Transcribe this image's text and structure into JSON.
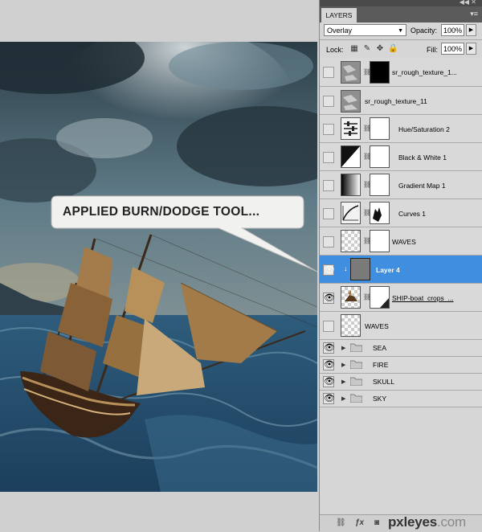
{
  "callout": {
    "text": "APPLIED BURN/DODGE TOOL..."
  },
  "panel": {
    "tab_label": "LAYERS",
    "blend_mode": "Overlay",
    "opacity_label": "Opacity:",
    "opacity_value": "100%",
    "lock_label": "Lock:",
    "fill_label": "Fill:",
    "fill_value": "100%",
    "layers": [
      {
        "name": "sr_rough_texture_1...",
        "visible": false,
        "icons": [
          "texture-thumbnail",
          "link-icon",
          "black-mask-thumbnail"
        ]
      },
      {
        "name": "sr_rough_texture_11",
        "visible": false,
        "icons": [
          "texture-thumbnail"
        ]
      },
      {
        "name": "Hue/Saturation 2",
        "visible": false,
        "icons": [
          "hue-saturation-adjustment-icon",
          "link-icon",
          "white-mask-thumbnail"
        ]
      },
      {
        "name": "Black & White 1",
        "visible": false,
        "icons": [
          "black-white-adjustment-icon",
          "link-icon",
          "white-mask-thumbnail"
        ]
      },
      {
        "name": "Gradient Map 1",
        "visible": false,
        "icons": [
          "gradient-map-adjustment-icon",
          "link-icon",
          "white-mask-thumbnail"
        ]
      },
      {
        "name": "Curves 1",
        "visible": false,
        "icons": [
          "curves-adjustment-icon",
          "link-icon",
          "mask-thumbnail"
        ]
      },
      {
        "name": "WAVES",
        "visible": false,
        "icons": [
          "transparent-thumbnail",
          "link-icon",
          "white-mask-thumbnail"
        ]
      },
      {
        "name": "Layer 4",
        "visible": true,
        "selected": true,
        "icons": [
          "gray-layer-thumbnail"
        ]
      },
      {
        "name": "SHIP-boat_crops_...",
        "visible": true,
        "icons": [
          "ship-thumbnail",
          "link-icon",
          "white-mask-thumbnail"
        ]
      },
      {
        "name": "WAVES",
        "visible": false,
        "icons": [
          "transparent-thumbnail"
        ]
      }
    ],
    "groups": [
      {
        "name": "SEA",
        "visible": true
      },
      {
        "name": "FIRE",
        "visible": true
      },
      {
        "name": "SKULL",
        "visible": true
      },
      {
        "name": "SKY",
        "visible": true
      }
    ]
  },
  "watermark": {
    "brand": "pxleyes",
    "suffix": ".com"
  }
}
